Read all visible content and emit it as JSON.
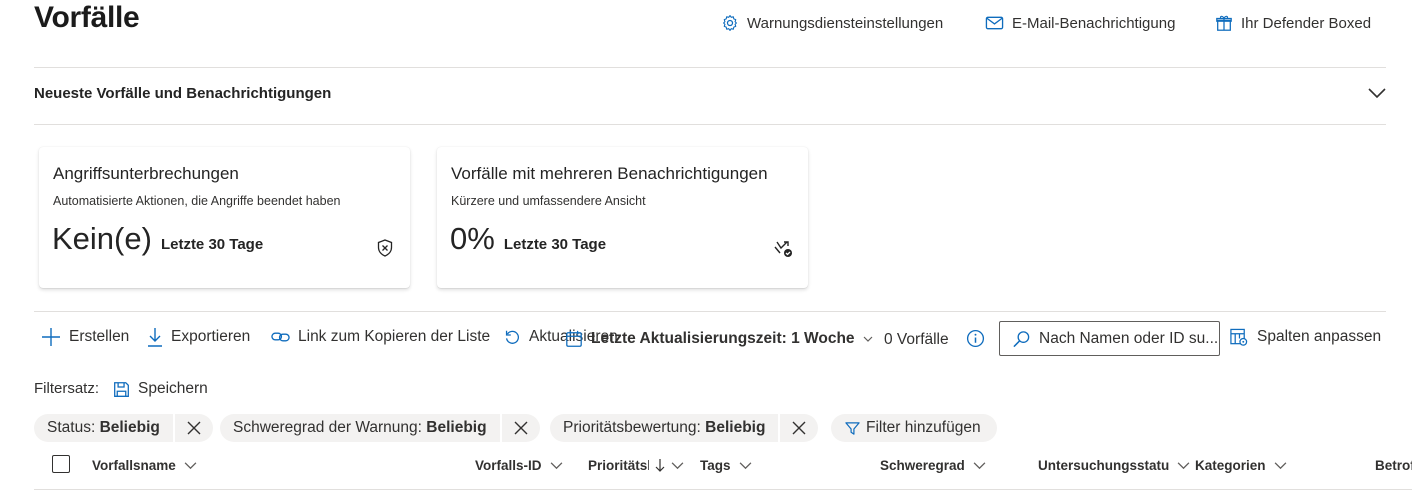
{
  "page": {
    "title": "Vorfälle"
  },
  "header_links": [
    {
      "label": "Warnungsdiensteinstellungen",
      "icon": "gear-icon"
    },
    {
      "label": "E-Mail-Benachrichtigung",
      "icon": "mail-icon"
    },
    {
      "label": "Ihr Defender Boxed",
      "icon": "gift-icon"
    }
  ],
  "section": {
    "title": "Neueste Vorfälle und Benachrichtigungen",
    "expanded": true
  },
  "cards": [
    {
      "title": "Angriffsunterbrechungen",
      "subtitle": "Automatisierte Aktionen, die Angriffe beendet haben",
      "value": "Kein(e)",
      "period": "Letzte 30 Tage",
      "icon": "shield-x-icon"
    },
    {
      "title": "Vorfälle mit mehreren Benachrichtigungen",
      "subtitle": "Kürzere und umfassendere Ansicht",
      "value": "0%",
      "period": "Letzte 30 Tage",
      "icon": "merge-check-icon"
    }
  ],
  "toolbar": {
    "create": "Erstellen",
    "export": "Exportieren",
    "copy_link": "Link zum Kopieren der Liste",
    "refresh": "Aktualisieren",
    "time_filter": "Letzte Aktualisierungszeit: 1 Woche",
    "count": "0 Vorfälle",
    "search_placeholder": "Nach Namen oder ID su...",
    "customize_columns": "Spalten anpassen"
  },
  "filters": {
    "label": "Filtersatz:",
    "save": "Speichern",
    "pills": [
      {
        "name": "Status:",
        "value": "Beliebig"
      },
      {
        "name": "Schweregrad der Warnung:",
        "value": "Beliebig"
      },
      {
        "name": "Prioritätsbewertung:",
        "value": "Beliebig"
      }
    ],
    "add": "Filter hinzufügen"
  },
  "table": {
    "columns": [
      "Vorfallsname",
      "Vorfalls-ID",
      "Prioritätsk",
      "Tags",
      "Schweregrad",
      "Untersuchungsstatu",
      "Kategorien",
      "Betrof"
    ]
  },
  "colors": {
    "accent": "#0f6cbd",
    "divider": "#e1dfdd",
    "pill_bg": "#f3f2f1"
  }
}
